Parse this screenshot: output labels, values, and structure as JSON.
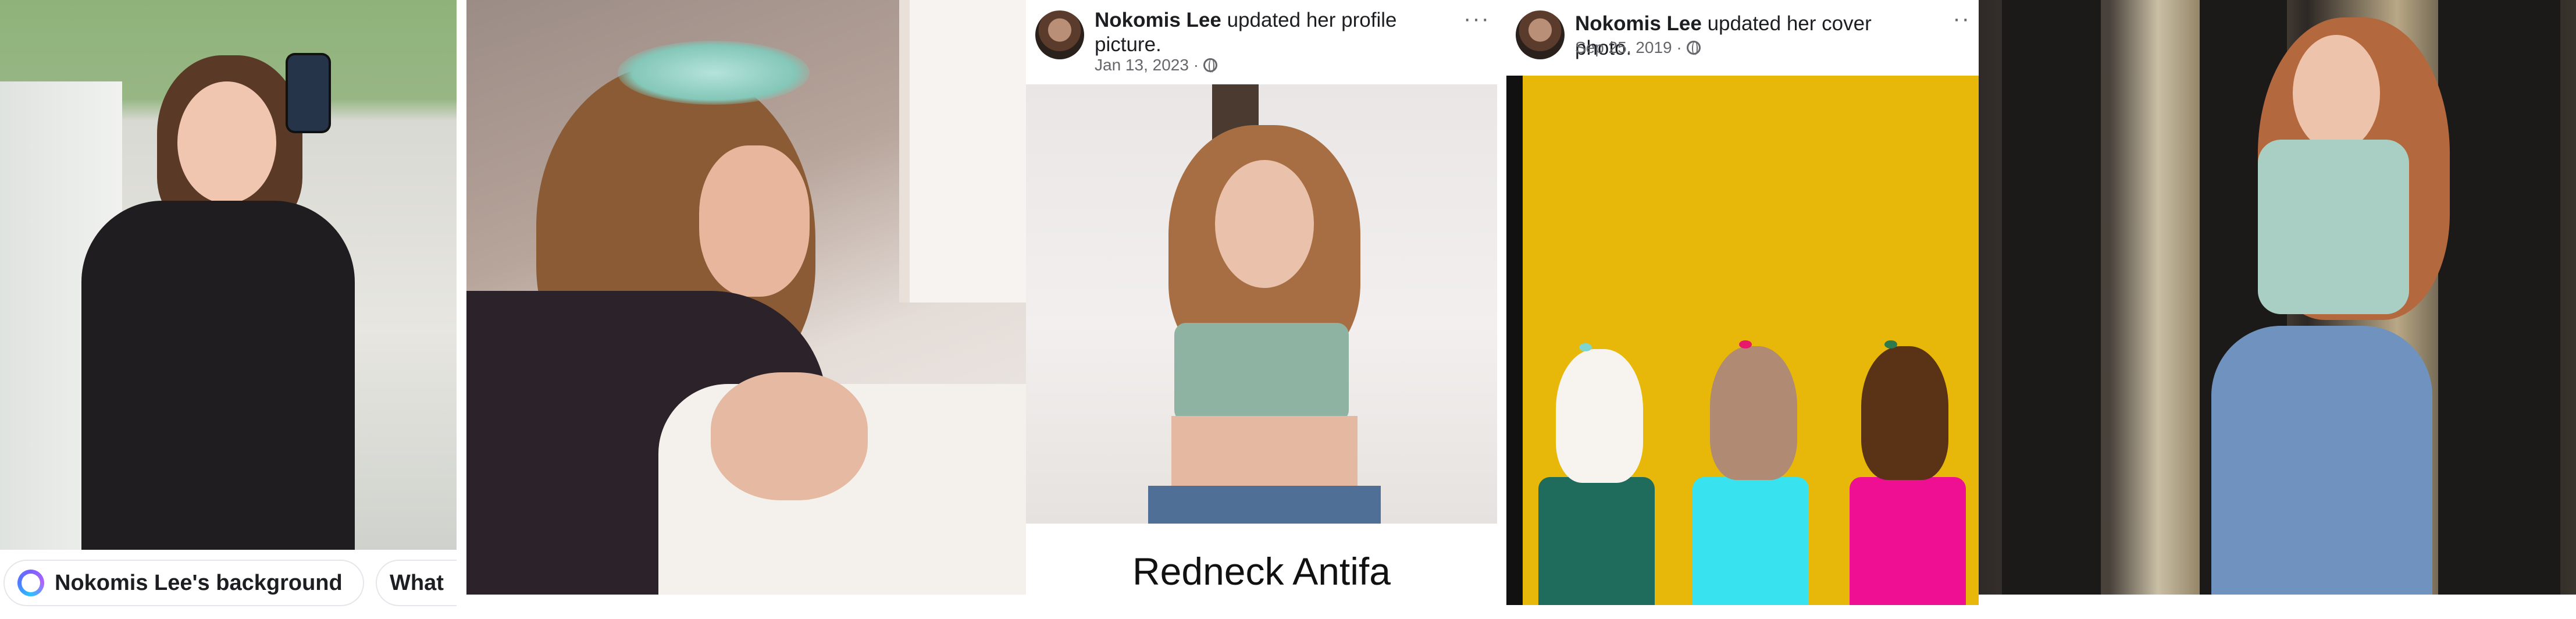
{
  "chips": {
    "background_label": "Nokomis Lee's background",
    "second_label": "What"
  },
  "profile_post": {
    "author": "Nokomis Lee",
    "action": "updated her profile picture.",
    "date": "Jan 13, 2023",
    "caption": "Redneck Antifa",
    "more": "···"
  },
  "cover_post": {
    "author": "Nokomis Lee",
    "action": "updated her cover photo.",
    "date": "Sep 25, 2019",
    "more": "··"
  },
  "colors": {
    "cover_background": "#e7b80a",
    "fist_light": "#f7f4ef",
    "fist_medium": "#b08a72",
    "fist_dark": "#5a3316",
    "sleeve_green": "#1f6b5c",
    "sleeve_cyan": "#38e3ef",
    "sleeve_magenta": "#ef0f93"
  }
}
